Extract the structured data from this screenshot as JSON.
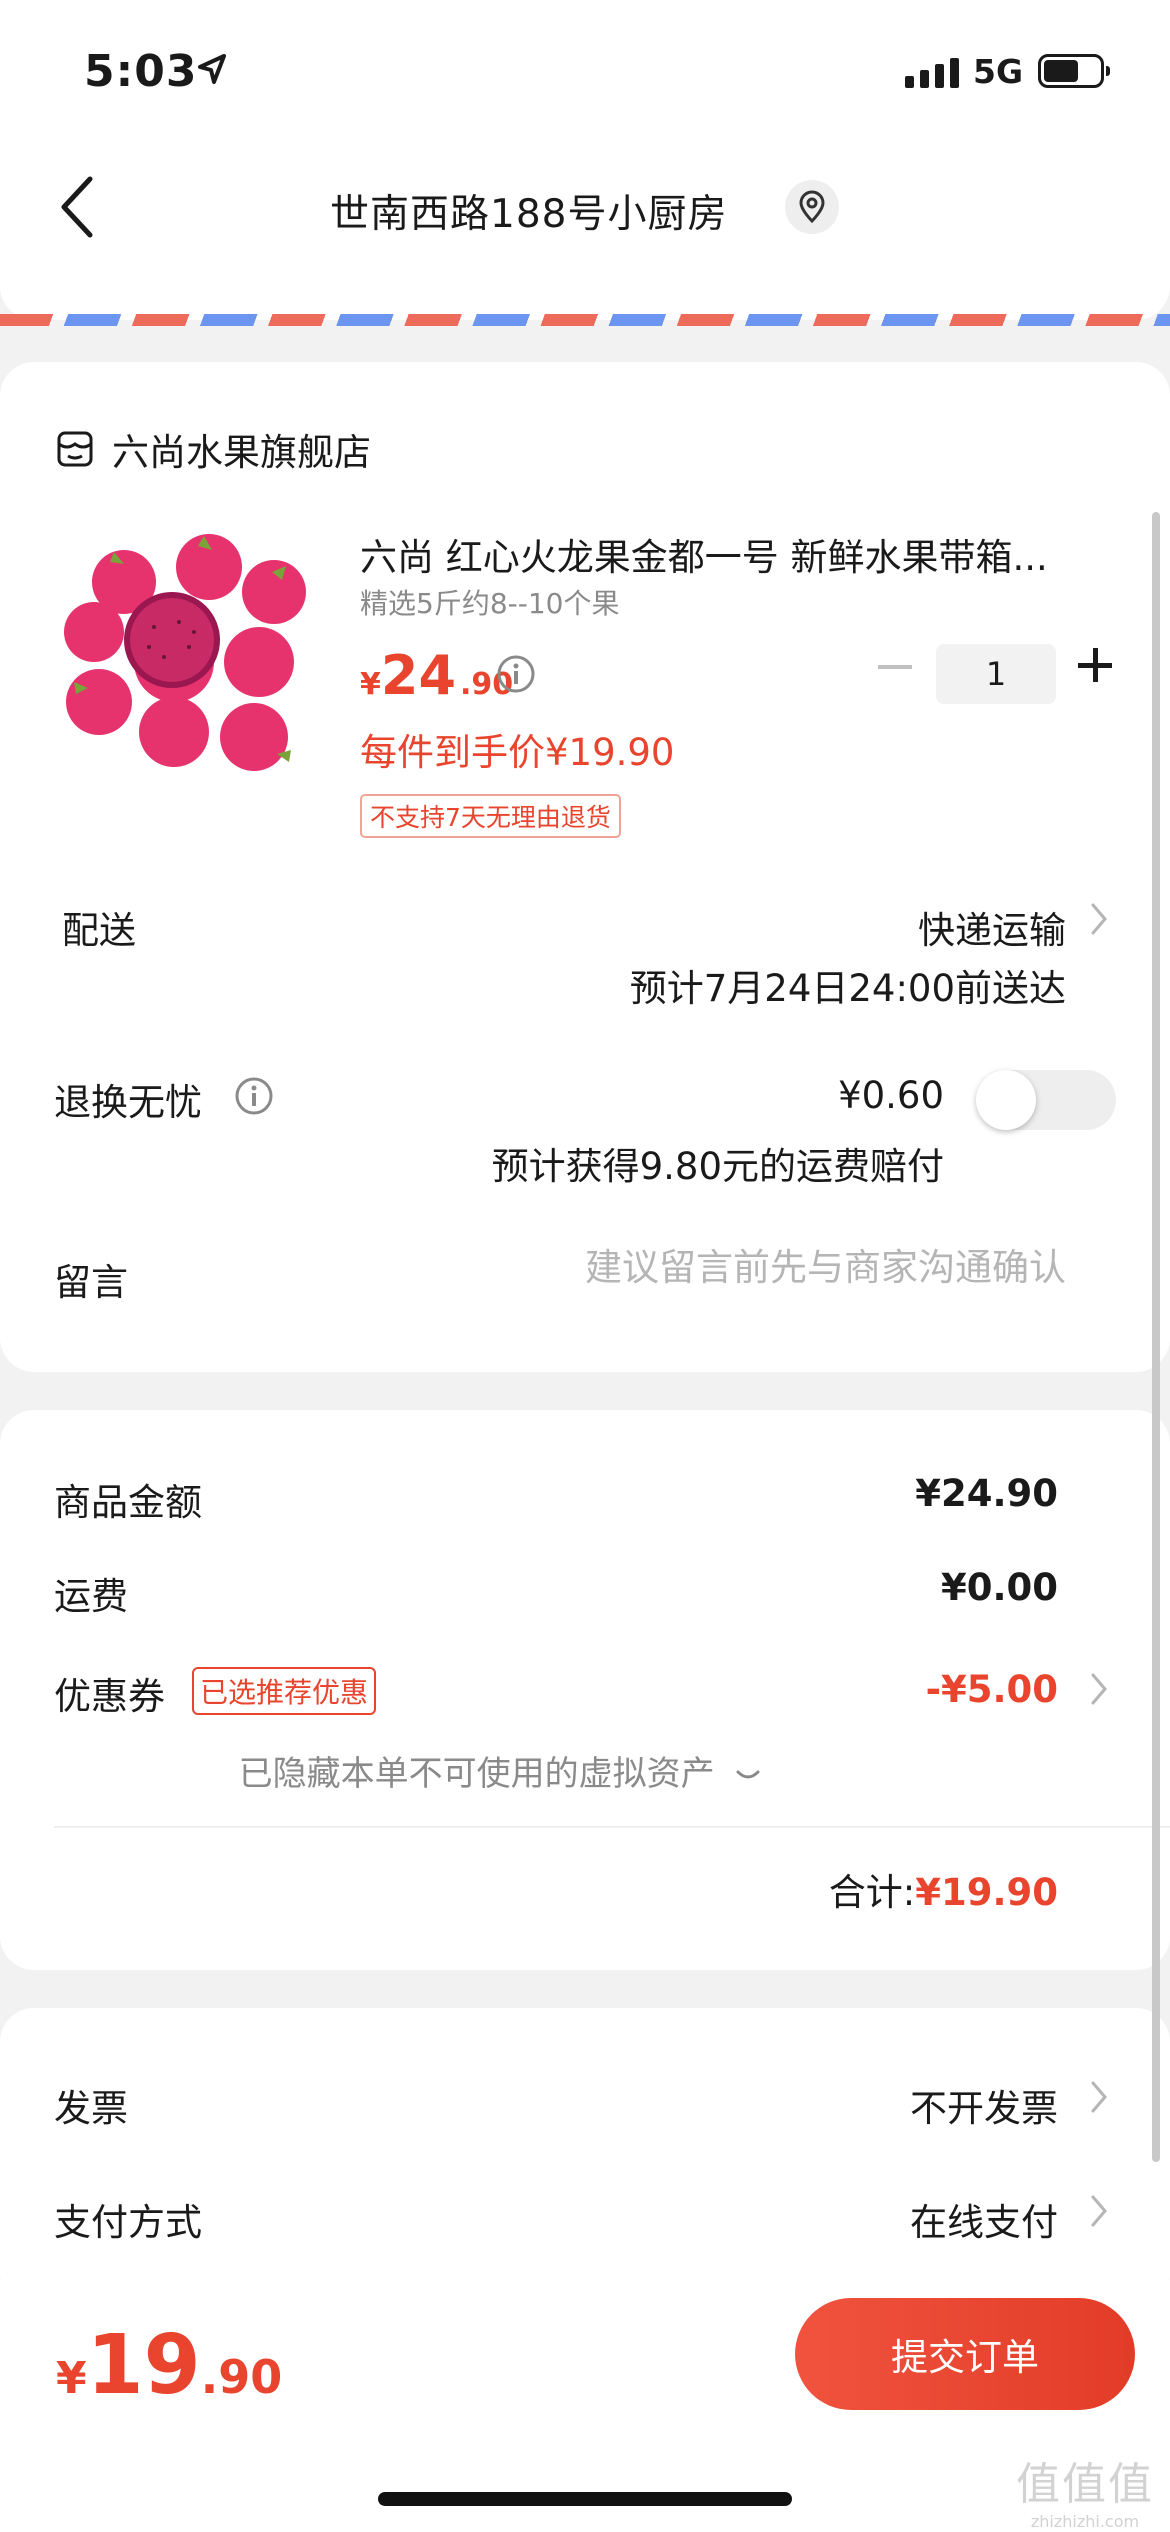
{
  "status_bar": {
    "time": "5:03",
    "network": "5G"
  },
  "header": {
    "address": "世南西路188号小厨房"
  },
  "store": {
    "name": "六尚水果旗舰店"
  },
  "product": {
    "title": "六尚 红心火龙果金都一号 新鲜水果带箱...",
    "spec": "精选5斤约8--10个果",
    "price_symbol": "¥",
    "price_int": "24",
    "price_dec": ".90",
    "final_price": "每件到手价¥19.90",
    "return_policy": "不支持7天无理由退货",
    "quantity": "1"
  },
  "delivery": {
    "label": "配送",
    "method": "快递运输",
    "eta": "预计7月24日24:00前送达"
  },
  "return_insurance": {
    "label": "退换无忧",
    "price": "¥0.60",
    "note": "预计获得9.80元的运费赔付",
    "enabled": false
  },
  "message": {
    "label": "留言",
    "placeholder": "建议留言前先与商家沟通确认"
  },
  "summary": {
    "goods_label": "商品金额",
    "goods_value": "¥24.90",
    "shipping_label": "运费",
    "shipping_value": "¥0.00",
    "coupon_label": "优惠券",
    "coupon_badge": "已选推荐优惠",
    "coupon_value": "-¥5.00",
    "hidden_assets": "已隐藏本单不可使用的虚拟资产",
    "total_label": "合计:",
    "total_value": "¥19.90"
  },
  "invoice": {
    "label": "发票",
    "value": "不开发票"
  },
  "payment": {
    "label": "支付方式",
    "value": "在线支付"
  },
  "bottom_bar": {
    "total_symbol": "¥",
    "total_int": "19",
    "total_dec": ".90",
    "submit_label": "提交订单"
  },
  "watermark": {
    "line1": "值值值",
    "line2": "zhizhizhi.com"
  },
  "colors": {
    "accent": "#e8442e",
    "text": "#1a1a1a",
    "muted": "#8a8a8a",
    "background": "#f2f2f2"
  }
}
